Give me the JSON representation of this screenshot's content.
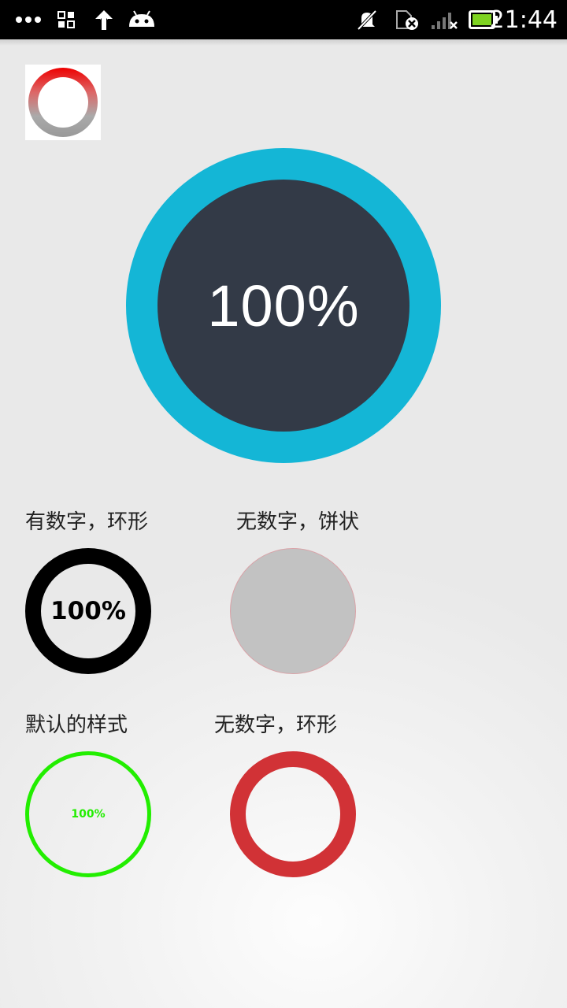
{
  "status_bar": {
    "time": "21:44",
    "left_icons": [
      "more-dots-icon",
      "apps-grid-icon",
      "upload-arrow-icon",
      "android-icon"
    ],
    "right_icons": [
      "notifications-off-icon",
      "sim-error-icon",
      "signal-none-icon",
      "battery-icon"
    ]
  },
  "main_progress": {
    "value_text": "100%",
    "progress": 1.0,
    "ring_color": "#14b6d6",
    "center_color": "#333a47"
  },
  "examples": [
    {
      "label": "有数字，环形",
      "value_text": "100%",
      "color": "#000000",
      "style": "ring-with-number"
    },
    {
      "label": "无数字，饼状",
      "color": "#c2c2c2",
      "style": "pie-without-number"
    },
    {
      "label": "默认的样式",
      "value_text": "100%",
      "color": "#22ee00",
      "style": "default"
    },
    {
      "label": "无数字，环形",
      "color": "#d13236",
      "style": "ring-without-number"
    }
  ]
}
